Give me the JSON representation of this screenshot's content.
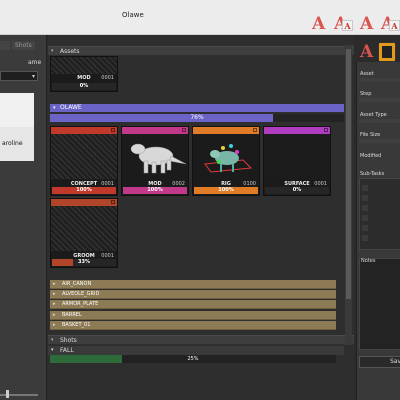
{
  "window": {
    "title": "Olawe"
  },
  "left_panel": {
    "tabs": [
      "Shots"
    ],
    "label": "ame",
    "selected_value": "",
    "user_card_name": "aroline"
  },
  "sections": {
    "assets": "Assets",
    "shots": "Shots"
  },
  "asset_strip": [
    {
      "name": "MOD",
      "number": "0001",
      "progress_text": "0%",
      "progress": 0,
      "color": "#1a1a1a"
    }
  ],
  "olawe": {
    "name": "OLAWE",
    "progress_text": "76%",
    "progress": 0.76,
    "color": "#6b63c6",
    "tasks": [
      {
        "name": "CONCEPT",
        "number": "0001",
        "progress_text": "100%",
        "progress": 1.0,
        "color": "#c0392b"
      },
      {
        "name": "MOD",
        "number": "0002",
        "progress_text": "100%",
        "progress": 1.0,
        "color": "#c2398a"
      },
      {
        "name": "RIG",
        "number": "0100",
        "progress_text": "100%",
        "progress": 1.0,
        "color": "#e07b28"
      },
      {
        "name": "SURFACE",
        "number": "0001",
        "progress_text": "0%",
        "progress": 0.0,
        "color": "#b03dc0"
      },
      {
        "name": "GROOM",
        "number": "0001",
        "progress_text": "33%",
        "progress": 0.33,
        "color": "#b0452a"
      }
    ]
  },
  "projects": [
    "AIR_CANON",
    "ALVEOLE_GRID",
    "ARMOR_PLATE",
    "BARREL",
    "BASKET_01"
  ],
  "shots": {
    "name": "FALL",
    "progress_text": "25%",
    "progress": 0.25
  },
  "right_panel": {
    "fields": [
      "Asset",
      "Step",
      "Asset Type",
      "File Size",
      "Modified"
    ],
    "subtasks_label": "Sub-Tasks",
    "notes_label": "Notes",
    "save_label": "Sav"
  },
  "app_icons": [
    "A",
    "A",
    "A",
    "A"
  ],
  "colors": {
    "accent": "#6b63c6",
    "projects": "#8d7b55",
    "icon_red": "#d9534f",
    "tool_orange": "#e39a1a"
  }
}
